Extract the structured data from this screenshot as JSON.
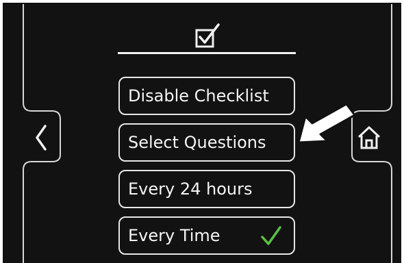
{
  "screen": {
    "title_icon": "checkbox-checked-icon"
  },
  "menu": {
    "items": [
      {
        "label": "Disable Checklist",
        "selected": false
      },
      {
        "label": "Select Questions",
        "selected": false
      },
      {
        "label": "Every 24 hours",
        "selected": false
      },
      {
        "label": "Every Time",
        "selected": true
      }
    ]
  },
  "nav": {
    "back_icon": "chevron-left-icon",
    "home_icon": "home-icon"
  },
  "annotation": {
    "arrow_icon": "pointer-arrow-icon",
    "arrow_color": "#ffffff"
  },
  "colors": {
    "background": "#121212",
    "foreground": "#f0f0f0",
    "check_accent": "#5cc246"
  }
}
